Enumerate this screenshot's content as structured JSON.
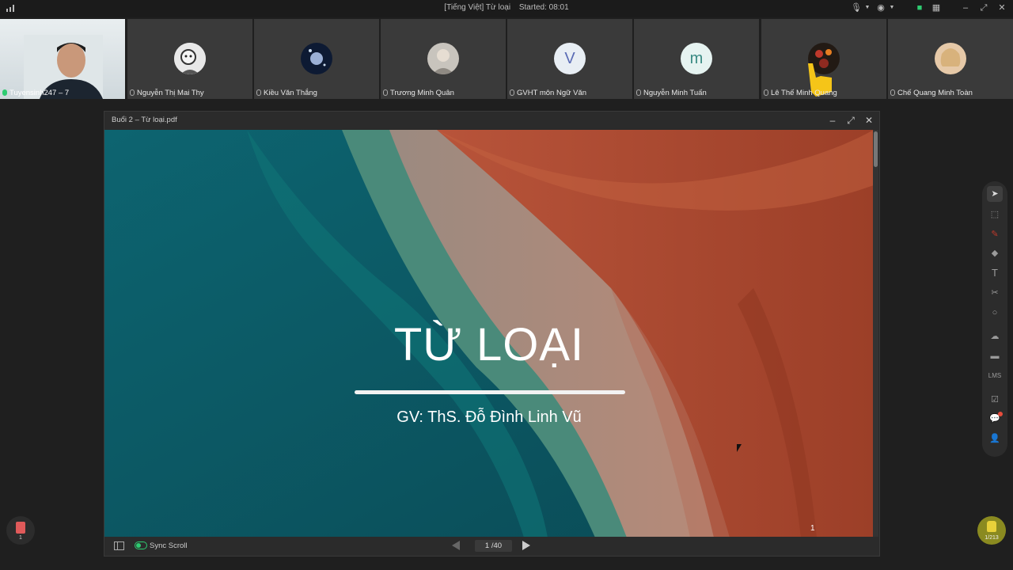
{
  "topbar": {
    "room_title": "[Tiếng Việt] Từ loại",
    "started_label": "Started: 08:01"
  },
  "participants": [
    {
      "name": "Tuyensinh247 – 7",
      "type": "camera"
    },
    {
      "name": "Nguyễn Thị Mai Thy",
      "type": "avatar"
    },
    {
      "name": "Kiều Văn Thắng",
      "type": "avatar"
    },
    {
      "name": "Trương Minh Quân",
      "type": "avatar"
    },
    {
      "name": "GVHT môn Ngữ Văn",
      "type": "letter",
      "letter": "V"
    },
    {
      "name": "Nguyễn Minh Tuấn",
      "type": "letter",
      "letter": "m"
    },
    {
      "name": "Lê Thế Minh Quang",
      "type": "avatar"
    },
    {
      "name": "Chế Quang Minh Toàn",
      "type": "avatar"
    }
  ],
  "viewer": {
    "title": "Buổi 2 – Từ loại.pdf",
    "slide": {
      "title": "TỪ LOẠI",
      "subtitle": "GV: ThS. Đỗ Đình Linh Vũ",
      "page_number": "1"
    },
    "footer": {
      "sync_label": "Sync Scroll",
      "page_indicator": "1 /40"
    }
  },
  "toolbar_icons": [
    "select-icon",
    "region-select-icon",
    "pen-icon",
    "eraser-icon",
    "text-icon",
    "scissors-icon",
    "shape-icon",
    "cloud-icon",
    "toolbox-icon",
    "lms-icon",
    "edit-icon",
    "chat-icon",
    "users-icon"
  ],
  "toolbar": {
    "lms_label": "LMS"
  },
  "corner": {
    "pdf_count": "1",
    "hand_count": "1/213"
  },
  "colors": {
    "background": "#1f1f1f",
    "tile": "#3a3a3a",
    "accent_green": "#2ecc71",
    "slide_teal": "#0c5a66",
    "slide_rust": "#a54a32"
  }
}
